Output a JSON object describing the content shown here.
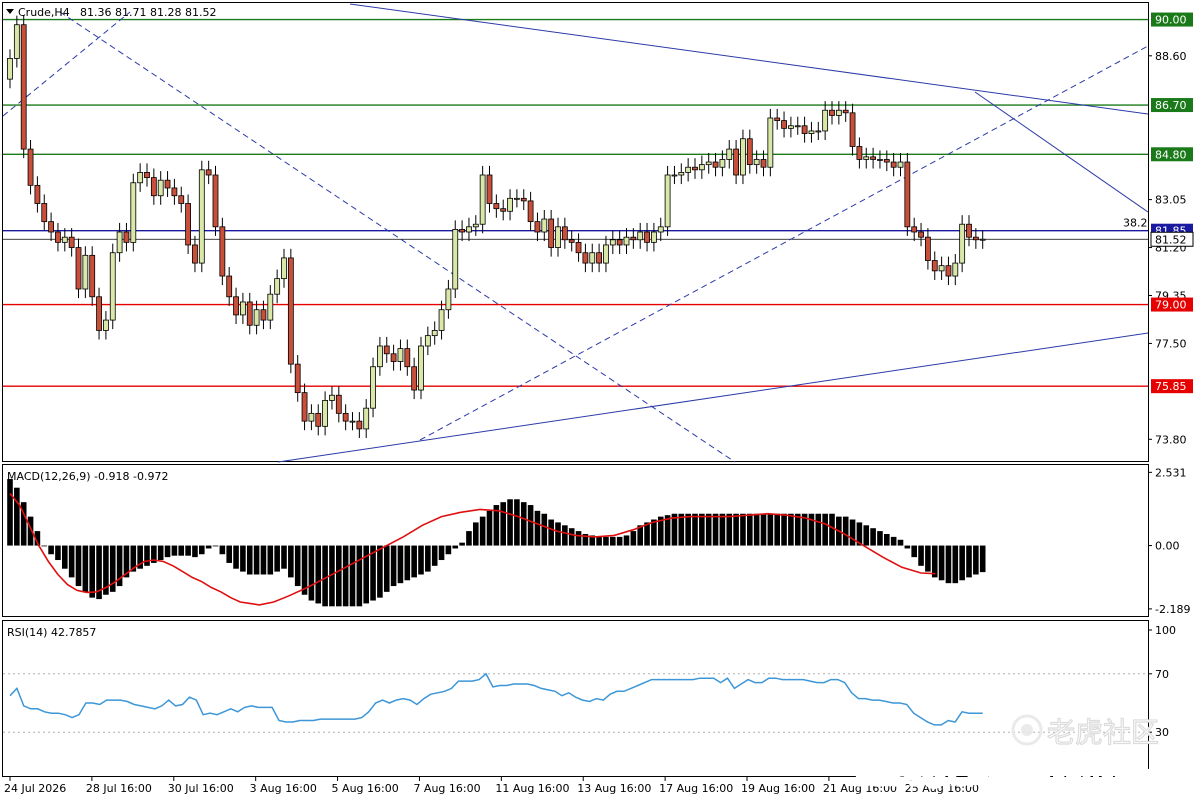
{
  "header": {
    "symbol": "Crude,H4",
    "ohlc": "81.36 81.71 81.28 81.52"
  },
  "colors": {
    "bull_fill": "#d9e8a8",
    "bear_fill": "#c8503a",
    "wick": "#000000",
    "support_resistance": "#1a7a1a",
    "red_level": "#e60000",
    "blue_level": "#1a1aa0",
    "trendline": "#2b3aa8",
    "macd_hist": "#000000",
    "macd_signal": "#e01010",
    "rsi_line": "#3c96d8",
    "rsi_levels": "#b0b0b0"
  },
  "chart_data": [
    {
      "type": "candlestick",
      "name": "price",
      "ylim": [
        73.0,
        90.6
      ],
      "yticks": [
        "90.00",
        "88.60",
        "86.70",
        "84.80",
        "83.05",
        "81.85",
        "81.20",
        "79.35",
        "79.00",
        "77.50",
        "75.85",
        "73.80"
      ],
      "levels": [
        {
          "value": 90.0,
          "label": "90.00",
          "color": "green"
        },
        {
          "value": 86.7,
          "label": "86.70",
          "color": "green"
        },
        {
          "value": 84.8,
          "label": "84.80",
          "color": "green"
        },
        {
          "value": 81.85,
          "label": "81.85",
          "color": "blue"
        },
        {
          "value": 81.52,
          "label": "81.52",
          "color": "price"
        },
        {
          "value": 79.0,
          "label": "79.00",
          "color": "red"
        },
        {
          "value": 75.85,
          "label": "75.85",
          "color": "red"
        }
      ],
      "annotation": "38.2",
      "xlabels": [
        "24 Jul 2026",
        "28 Jul 16:00",
        "30 Jul 16:00",
        "3 Aug 16:00",
        "5 Aug 16:00",
        "7 Aug 16:00",
        "11 Aug 16:00",
        "13 Aug 16:00",
        "17 Aug 16:00",
        "19 Aug 16:00",
        "21 Aug 16:00",
        "25 Aug 16:00"
      ],
      "closes": [
        88.5,
        89.8,
        85.0,
        83.6,
        82.9,
        82.2,
        81.8,
        81.4,
        81.6,
        81.2,
        79.6,
        80.9,
        79.3,
        78.0,
        78.4,
        81.0,
        81.8,
        81.4,
        83.7,
        84.1,
        83.9,
        83.2,
        83.8,
        83.5,
        83.2,
        82.9,
        81.3,
        80.6,
        84.2,
        84.0,
        82.0,
        80.1,
        79.3,
        78.6,
        79.1,
        78.2,
        78.8,
        78.4,
        79.4,
        80.0,
        80.8,
        76.7,
        75.6,
        74.5,
        74.8,
        74.3,
        75.3,
        75.5,
        74.8,
        74.5,
        74.5,
        74.2,
        75.0,
        76.6,
        77.4,
        77.1,
        76.8,
        77.3,
        76.6,
        75.7,
        77.4,
        77.8,
        78.0,
        78.8,
        79.6,
        81.9,
        81.8,
        82.0,
        82.1,
        84.0,
        82.9,
        82.7,
        82.6,
        83.1,
        83.1,
        83.0,
        82.2,
        81.8,
        82.3,
        81.2,
        82.0,
        81.5,
        81.4,
        81.0,
        80.6,
        81.0,
        80.6,
        81.3,
        81.5,
        81.3,
        81.6,
        81.5,
        81.8,
        81.4,
        81.8,
        82.0,
        84.0,
        84.0,
        84.1,
        84.3,
        84.2,
        84.4,
        84.5,
        84.3,
        84.6,
        85.0,
        84.0,
        85.4,
        84.4,
        84.6,
        84.3,
        86.2,
        86.1,
        85.8,
        85.9,
        85.9,
        85.6,
        85.7,
        85.7,
        86.5,
        86.3,
        86.5,
        86.4,
        85.1,
        84.6,
        84.7,
        84.6,
        84.6,
        84.5,
        84.3,
        84.5,
        82.0,
        81.8,
        81.6,
        80.7,
        80.3,
        80.5,
        80.1,
        80.6,
        82.1,
        81.6,
        81.5,
        81.52
      ],
      "high_ext": 0.35,
      "low_ext": 0.35
    },
    {
      "type": "bar+line",
      "name": "MACD",
      "title": "MACD(12,26,9) -0.918 -0.972",
      "ylim": [
        -2.4,
        2.75
      ],
      "yticks": [
        "2.531",
        "0.00",
        "-2.189"
      ],
      "histogram": [
        2.3,
        2.0,
        1.5,
        1.0,
        0.5,
        0.0,
        -0.3,
        -0.5,
        -0.8,
        -1.1,
        -1.4,
        -1.6,
        -1.8,
        -1.85,
        -1.7,
        -1.6,
        -1.4,
        -1.1,
        -0.9,
        -0.8,
        -0.7,
        -0.6,
        -0.5,
        -0.4,
        -0.35,
        -0.35,
        -0.35,
        -0.4,
        -0.3,
        -0.1,
        0.0,
        -0.3,
        -0.6,
        -0.8,
        -0.9,
        -1.0,
        -1.0,
        -1.0,
        -1.0,
        -0.9,
        -0.8,
        -1.1,
        -1.4,
        -1.7,
        -1.9,
        -2.0,
        -2.1,
        -2.1,
        -2.1,
        -2.1,
        -2.1,
        -2.1,
        -2.0,
        -1.9,
        -1.8,
        -1.6,
        -1.4,
        -1.3,
        -1.2,
        -1.1,
        -1.0,
        -0.9,
        -0.7,
        -0.5,
        -0.3,
        -0.1,
        0.1,
        0.5,
        0.8,
        1.0,
        1.2,
        1.4,
        1.5,
        1.6,
        1.6,
        1.5,
        1.4,
        1.2,
        1.1,
        0.9,
        0.8,
        0.7,
        0.6,
        0.5,
        0.4,
        0.35,
        0.3,
        0.3,
        0.3,
        0.3,
        0.35,
        0.5,
        0.7,
        0.8,
        0.9,
        1.0,
        1.05,
        1.1,
        1.1,
        1.1,
        1.1,
        1.1,
        1.1,
        1.1,
        1.1,
        1.1,
        1.1,
        1.1,
        1.1,
        1.1,
        1.1,
        1.1,
        1.1,
        1.1,
        1.1,
        1.1,
        1.1,
        1.1,
        1.1,
        1.1,
        1.1,
        1.0,
        1.0,
        0.9,
        0.8,
        0.7,
        0.6,
        0.5,
        0.4,
        0.3,
        0.2,
        -0.1,
        -0.4,
        -0.7,
        -0.9,
        -1.1,
        -1.2,
        -1.3,
        -1.3,
        -1.2,
        -1.1,
        -1.0,
        -0.918
      ],
      "signal": [
        1.8,
        1.4,
        0.7,
        0.0,
        -0.55,
        -1.0,
        -1.35,
        -1.55,
        -1.62,
        -1.6,
        -1.45,
        -1.25,
        -1.0,
        -0.75,
        -0.55,
        -0.5,
        -0.55,
        -0.7,
        -0.9,
        -1.1,
        -1.25,
        -1.45,
        -1.6,
        -1.8,
        -1.95,
        -2.0,
        -2.05,
        -1.95,
        -1.75,
        -1.45,
        -1.1,
        -0.75,
        -0.4,
        -0.05,
        0.3,
        0.7,
        1.0,
        1.15,
        1.25,
        1.2,
        1.0,
        0.75,
        0.5,
        0.35,
        0.3,
        0.35,
        0.55,
        0.8,
        0.95,
        1.0,
        1.0,
        1.0,
        1.05,
        1.1,
        1.05,
        0.95,
        0.75,
        0.4,
        0.0,
        -0.4,
        -0.75,
        -0.95,
        -0.972
      ],
      "signal_x": [
        0,
        2,
        4,
        6,
        8,
        10,
        12,
        14,
        16,
        18,
        20,
        22,
        24,
        26,
        28,
        30,
        32,
        34,
        36,
        38,
        40,
        42,
        44,
        46,
        48,
        50,
        52,
        55,
        58,
        62,
        66,
        70,
        74,
        78,
        82,
        86,
        90,
        94,
        98,
        102,
        106,
        110,
        114,
        118,
        122,
        126,
        130,
        134,
        138,
        142,
        146,
        150,
        154,
        158,
        162,
        166,
        170,
        174,
        178,
        182,
        186,
        190,
        193
      ]
    },
    {
      "type": "line",
      "name": "RSI",
      "title": "RSI(14) 42.7857",
      "ylim": [
        0,
        100
      ],
      "yticks": [
        "100",
        "70",
        "30"
      ],
      "levels": [
        70,
        30
      ],
      "values": [
        55,
        60,
        48,
        46,
        46,
        44,
        43,
        43,
        42,
        40,
        42,
        50,
        50,
        49,
        52,
        52,
        52,
        51,
        49,
        48,
        47,
        46,
        48,
        52,
        48,
        49,
        54,
        52,
        42,
        43,
        42,
        44,
        46,
        44,
        47,
        48,
        47,
        47,
        47,
        38,
        37,
        37,
        38,
        38,
        38,
        39,
        39,
        39,
        39,
        39,
        39,
        40,
        44,
        50,
        52,
        50,
        52,
        53,
        52,
        49,
        53,
        56,
        57,
        58,
        60,
        65,
        65,
        65,
        66,
        70,
        61,
        62,
        62,
        63,
        63,
        63,
        62,
        60,
        59,
        58,
        55,
        57,
        54,
        52,
        51,
        53,
        52,
        56,
        58,
        58,
        60,
        62,
        64,
        66,
        66,
        66,
        66,
        66,
        66,
        66,
        67,
        67,
        67,
        64,
        67,
        60,
        63,
        66,
        64,
        64,
        67,
        67,
        66,
        66,
        66,
        66,
        65,
        64,
        64,
        66,
        66,
        64,
        57,
        53,
        53,
        52,
        52,
        51,
        50,
        50,
        49,
        43,
        40,
        37,
        35,
        35,
        38,
        37,
        44,
        43,
        43,
        43
      ]
    }
  ],
  "watermark": {
    "line1": "老虎社区",
    "line2": "搜狐号@汇商传媒Forexpress"
  }
}
